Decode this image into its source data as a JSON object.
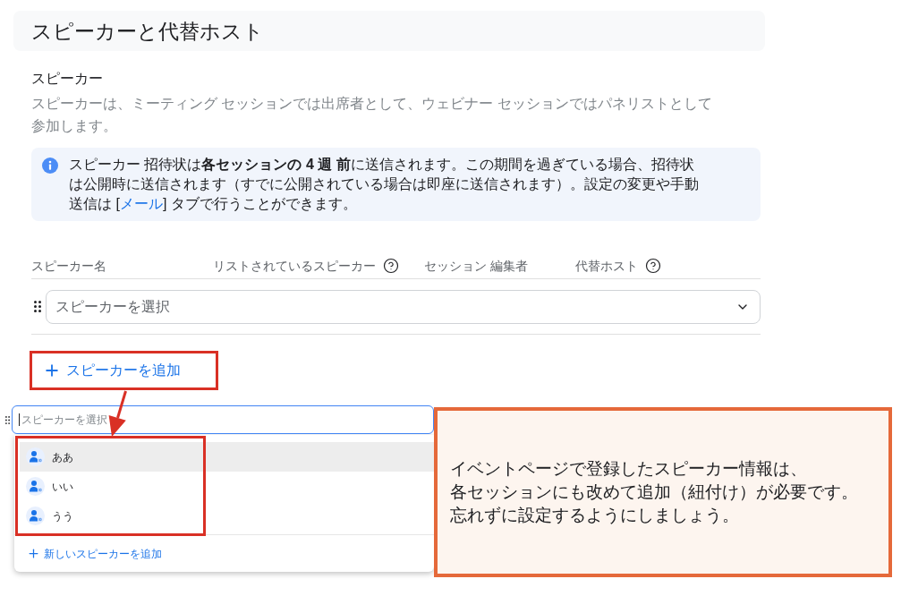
{
  "header": {
    "title": "スピーカーと代替ホスト"
  },
  "section": {
    "title": "スピーカー",
    "description": "スピーカーは、ミーティング セッションでは出席者として、ウェビナー セッションではパネリストとして参加します。"
  },
  "info_banner": {
    "text": "スピーカー 招待状は**各セッションの 4 週 前**に送信されます。この期間を過ぎている場合、招待状は公開時に送信されます（すでに公開されている場合は即座に送信されます）。設定の変更や手動送信は [",
    "link": "メール",
    "text_end": "] タブで行うことができます。"
  },
  "table": {
    "columns": [
      {
        "label": "スピーカー名",
        "help": false
      },
      {
        "label": "リストされているスピーカー",
        "help": true
      },
      {
        "label": "セッション 編集者",
        "help": false
      },
      {
        "label": "代替ホスト",
        "help": true
      }
    ],
    "rows": [
      {
        "placeholder": "スピーカーを選択"
      }
    ]
  },
  "add_button": {
    "label": "スピーカーを追加",
    "framed": true
  },
  "dropdown_preview": {
    "placeholder": "スピーカーを選択",
    "framed": true,
    "options": [
      {
        "label": "ああ",
        "highlighted": true
      },
      {
        "label": "いい",
        "highlighted": false
      },
      {
        "label": "うう",
        "highlighted": false
      }
    ],
    "add_new": "新しいスピーカーを追加"
  },
  "callout": {
    "lines": [
      "イベントページで登録したスピーカー情報は、",
      "各セッションにも改めて追加（紐付け）が必要です。",
      "忘れずに設定するようにしましょう。"
    ]
  }
}
